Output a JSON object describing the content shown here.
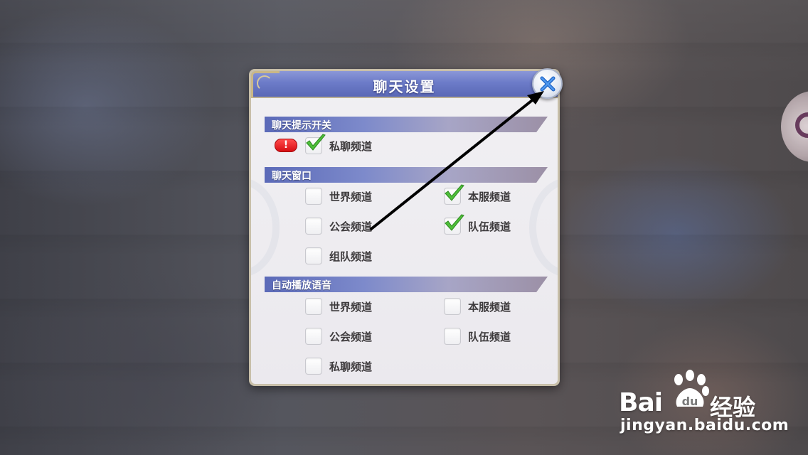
{
  "dialog": {
    "title": "聊天设置",
    "sections": [
      {
        "label": "聊天提示开关",
        "alert_badge": "!",
        "options": [
          {
            "label": "私聊频道",
            "checked": true
          }
        ]
      },
      {
        "label": "聊天窗口",
        "options": [
          {
            "label": "世界频道",
            "checked": false
          },
          {
            "label": "本服频道",
            "checked": true
          },
          {
            "label": "公会频道",
            "checked": false
          },
          {
            "label": "队伍频道",
            "checked": true
          },
          {
            "label": "组队频道",
            "checked": false
          }
        ]
      },
      {
        "label": "自动播放语音",
        "options": [
          {
            "label": "世界频道",
            "checked": false
          },
          {
            "label": "本服频道",
            "checked": false
          },
          {
            "label": "公会频道",
            "checked": false
          },
          {
            "label": "队伍频道",
            "checked": false
          },
          {
            "label": "私聊频道",
            "checked": false
          }
        ]
      }
    ]
  },
  "icons": {
    "close": "close-icon",
    "check": "checkmark-icon",
    "alert": "exclamation-icon"
  },
  "watermark": {
    "brand": "Bai",
    "brand_suffix": "du",
    "cn": "经验",
    "url": "jingyan.baidu.com"
  },
  "colors": {
    "title_bar": "#6c7bc8",
    "check_green": "#4fbf3a",
    "alert_red": "#d80e13"
  }
}
